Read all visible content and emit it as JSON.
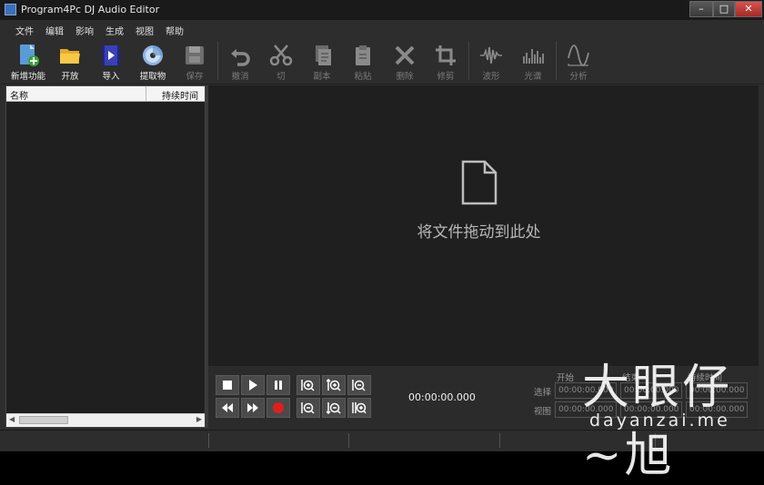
{
  "window": {
    "title": "Program4Pc DJ Audio Editor"
  },
  "menu": [
    "文件",
    "编辑",
    "影响",
    "生成",
    "视图",
    "帮助"
  ],
  "toolbar": {
    "new": "新增功能",
    "open": "开放",
    "import": "导入",
    "extract": "提取物",
    "save": "保存",
    "undo": "撤消",
    "cut": "切",
    "copy": "副本",
    "paste": "粘贴",
    "delete": "删除",
    "trim": "修剪",
    "waveform": "波形",
    "spectrum": "光谱",
    "analyze": "分析"
  },
  "filelist": {
    "col_name": "名称",
    "col_duration": "持续时间"
  },
  "main": {
    "drop_text": "将文件拖动到此处"
  },
  "transport": {
    "time": "00:00:00.000"
  },
  "selection": {
    "col_start": "开始",
    "col_end": "结束",
    "col_duration": "持续时间",
    "row_selection": "选择",
    "row_view": "视图",
    "selection_start": "00:00:00.000",
    "selection_end": "00:00:00.000",
    "selection_duration": "00:00:00.000",
    "view_start": "00:00:00.000",
    "view_end": "00:00:00.000",
    "view_duration": "00:00:00.000"
  },
  "watermark": {
    "text": "大眼仔~旭",
    "url": "dayanzai.me"
  },
  "colors": {
    "background": "#2d2d2d",
    "panel": "#1f1f1f",
    "record": "#e01e1e",
    "disabled": "#7a7a7a"
  }
}
